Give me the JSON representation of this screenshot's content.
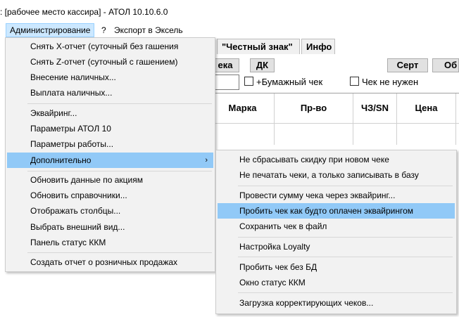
{
  "window": {
    "title": ": [рабочее место кассира] - АТОЛ 10.10.6.0"
  },
  "menubar": {
    "items": [
      "Администрирование",
      "?",
      "Экспорт в Эксель"
    ]
  },
  "background": {
    "tabs": [
      "\"Честный знак\"",
      "Инфо"
    ],
    "buttons": [
      "ека",
      "ДК",
      "Серт",
      "Об"
    ],
    "checkboxes": [
      "+Бумажный чек",
      "Чек не нужен"
    ],
    "grid_headers": [
      "Марка",
      "Пр-во",
      "ЧЗ/SN",
      "Цена"
    ]
  },
  "admin_menu": {
    "items": [
      "Снять X-отчет (суточный без гашения",
      "Снять Z-отчет (суточный с гашением)",
      "Внесение наличных...",
      "Выплата наличных...",
      "Эквайринг...",
      "Параметры АТОЛ 10",
      "Параметры работы...",
      "Дополнительно",
      "Обновить данные по акциям",
      "Обновить справочники...",
      "Отображать столбцы...",
      "Выбрать внешний вид...",
      "Панель статус ККМ",
      "Создать отчет о розничных продажах"
    ],
    "submenu_arrow": "›"
  },
  "sub_menu": {
    "items": [
      "Не сбрасывать скидку при новом чеке",
      "Не печатать чеки, а только записывать в базу",
      "Провести сумму чека через эквайринг...",
      "Пробить чек как будто оплачен эквайрингом",
      "Сохранить чек в файл",
      "Настройка Loyalty",
      "Пробить чек без БД",
      "Окно статус ККМ",
      "Загрузка корректирующих чеков..."
    ]
  },
  "colors": {
    "highlight": "#91c9f7",
    "menubar_active": "#cce8ff",
    "menu_bg": "#f2f2f2"
  }
}
